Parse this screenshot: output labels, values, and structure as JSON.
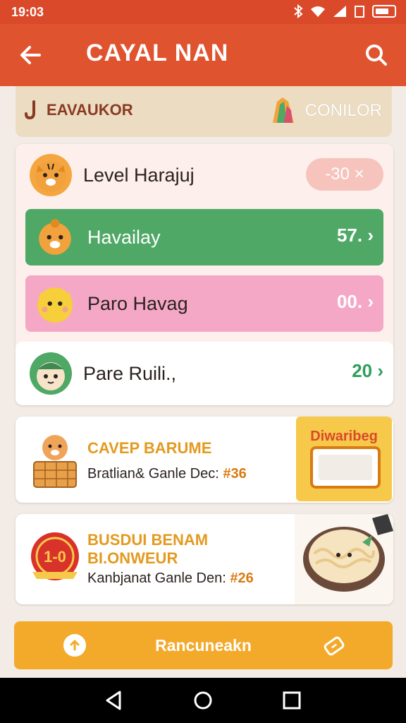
{
  "status_bar": {
    "time": "19:03"
  },
  "app_bar": {
    "title": "CAYAL NAN"
  },
  "sub_header": {
    "left_label": "EAVAUKOR",
    "right_label": "CONILOR"
  },
  "list": [
    {
      "label": "Level Harajuj",
      "value": "-30 ×"
    },
    {
      "label": "Havailay",
      "value": "57. ›"
    },
    {
      "label": "Paro Havag",
      "value": "00. ›"
    },
    {
      "label": "Pare Ruili.,",
      "value": "20 ›"
    }
  ],
  "promos": [
    {
      "title": "CAVEP BARUME",
      "desc_text": "Bratlian& Ganle Dec: ",
      "desc_num": "#36",
      "art_text": "Diwaribeg"
    },
    {
      "title": "BUSDUI BENAM\nBI.ONWEUR",
      "desc_text": "Kanbjanat Ganle Den: ",
      "desc_num": "#26",
      "badge_text": "1-0"
    }
  ],
  "cta": {
    "label": "Rancuneakn"
  },
  "colors": {
    "primary": "#e0532f",
    "green": "#4fa866",
    "pink": "#f5a8c6",
    "accent": "#f3aa2b"
  },
  "icons": [
    "back-arrow-icon",
    "search-icon",
    "tiger-face-icon",
    "upload-icon",
    "ticket-icon"
  ]
}
